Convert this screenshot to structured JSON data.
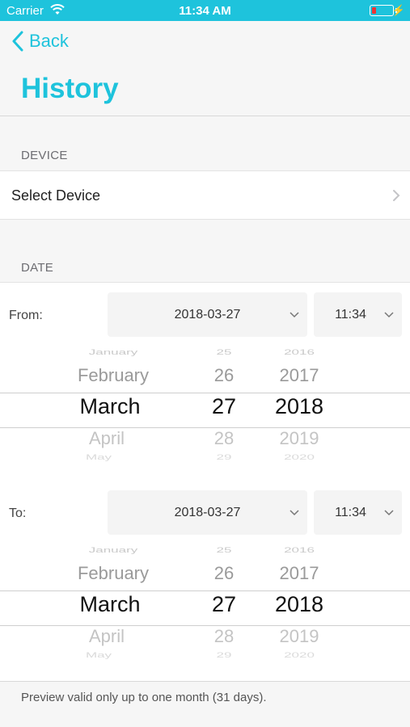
{
  "status_bar": {
    "carrier": "Carrier",
    "time": "11:34 AM"
  },
  "nav": {
    "back_label": "Back",
    "title": "History"
  },
  "device_section": {
    "header": "DEVICE",
    "select_label": "Select Device"
  },
  "date_section": {
    "header": "DATE",
    "from": {
      "label": "From:",
      "date_value": "2018-03-27",
      "time_value": "11:34",
      "picker": {
        "months": [
          "January",
          "February",
          "March",
          "April",
          "May"
        ],
        "days": [
          "25",
          "26",
          "27",
          "28",
          "29"
        ],
        "years": [
          "2016",
          "2017",
          "2018",
          "2019",
          "2020"
        ]
      }
    },
    "to": {
      "label": "To:",
      "date_value": "2018-03-27",
      "time_value": "11:34",
      "picker": {
        "months": [
          "January",
          "February",
          "March",
          "April",
          "May"
        ],
        "days": [
          "25",
          "26",
          "27",
          "28",
          "29"
        ],
        "years": [
          "2016",
          "2017",
          "2018",
          "2019",
          "2020"
        ]
      }
    }
  },
  "footer": {
    "note": "Preview valid only up to one month (31 days)."
  },
  "colors": {
    "accent": "#1ec3dc",
    "battery_low": "#ee3333"
  }
}
